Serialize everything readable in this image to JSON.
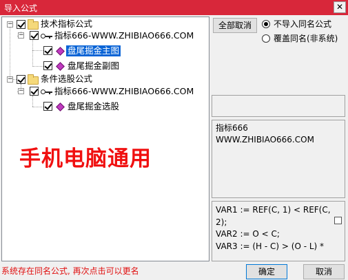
{
  "window": {
    "title": "导入公式",
    "close_glyph": "✕"
  },
  "tree": {
    "group1_label": "技术指标公式",
    "group1_formula_label": "指标666-WWW.ZHIBIAO666.COM",
    "group1_item1_label": "盘尾掘金主图",
    "group1_item2_label": "盘尾掘金副图",
    "group2_label": "条件选股公式",
    "group2_formula_label": "指标666-WWW.ZHIBIAO666.COM",
    "group2_item1_label": "盘尾掘金选股",
    "expand_glyph": "−",
    "watermark": "手机电脑通用"
  },
  "options": {
    "deselect_all_label": "全部取消",
    "no_import_label": "不导入同名公式",
    "overwrite_label": "覆盖同名(非系统)"
  },
  "info": {
    "line1": "指标666",
    "line2": "WWW.ZHIBIAO666.COM"
  },
  "code": {
    "line1": "VAR1 := REF(C, 1) < REF(C,",
    "line2": "2);",
    "line3": "VAR2 := O < C;",
    "line4": "VAR3 := (H - C) > (O - L) *"
  },
  "footer": {
    "status": "系统存在同名公式, 再次点击可以更名",
    "ok_label": "确定",
    "cancel_label": "取消"
  },
  "colors": {
    "titlebar": "#d8273a",
    "selection": "#0a64d6",
    "watermark": "#f01010",
    "status": "#e01010"
  }
}
